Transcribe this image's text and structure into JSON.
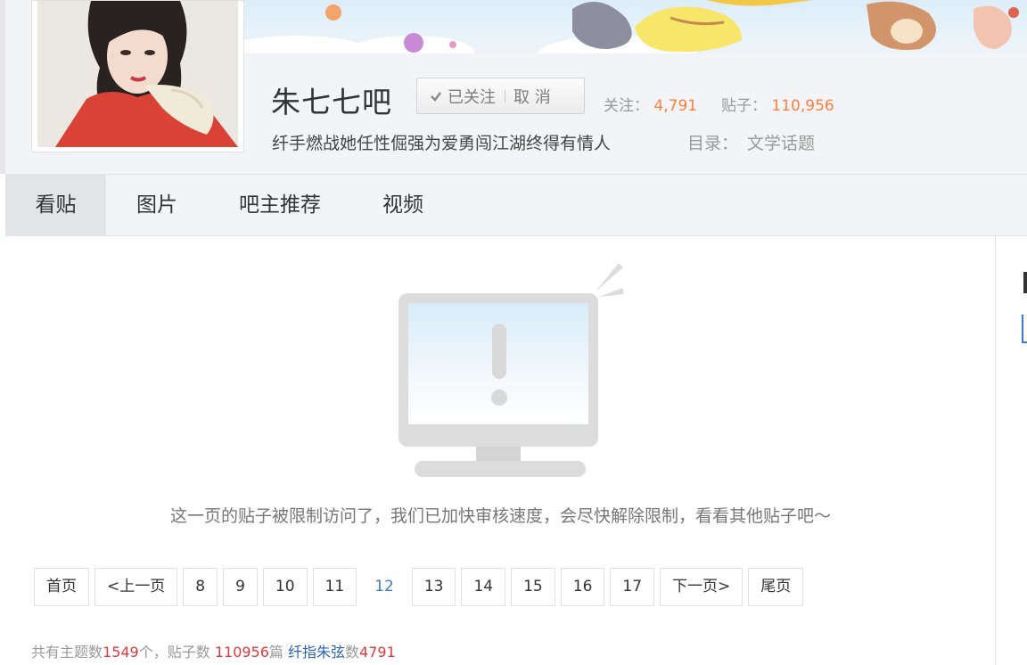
{
  "forum": {
    "name": "朱七七吧",
    "follow_status": "已关注",
    "cancel_label": "取 消",
    "follow_label": "关注：",
    "follow_count": "4,791",
    "posts_label": "贴子：",
    "posts_count": "110,956",
    "slogan": "纤手燃战她任性倔强为爱勇闯江湖终得有情人",
    "catalog_label": "目录：",
    "catalog_value": "文学话题"
  },
  "tabs": [
    {
      "label": "看贴",
      "active": true
    },
    {
      "label": "图片",
      "active": false
    },
    {
      "label": "吧主推荐",
      "active": false
    },
    {
      "label": "视频",
      "active": false
    }
  ],
  "content": {
    "limit_message": "这一页的贴子被限制访问了，我们已加快审核速度，会尽快解除限制，看看其他贴子吧～"
  },
  "pager": {
    "first": "首页",
    "prev": "<上一页",
    "pages": [
      "8",
      "9",
      "10",
      "11",
      "12",
      "13",
      "14",
      "15",
      "16",
      "17"
    ],
    "current": "12",
    "next": "下一页>",
    "last": "尾页"
  },
  "summary": {
    "topics_prefix": "共有主题数",
    "topics_count": "1549",
    "posts_prefix": "个，贴子数 ",
    "posts_count": "110956",
    "posts_suffix": "篇 ",
    "member_name": "纤指朱弦",
    "member_prefix": "数",
    "member_count": "4791"
  },
  "colors": {
    "accent_orange": "#ff7f3e",
    "accent_red": "#e2393d",
    "link_blue": "#2d64b3",
    "current_page": "#3e7bd8"
  }
}
